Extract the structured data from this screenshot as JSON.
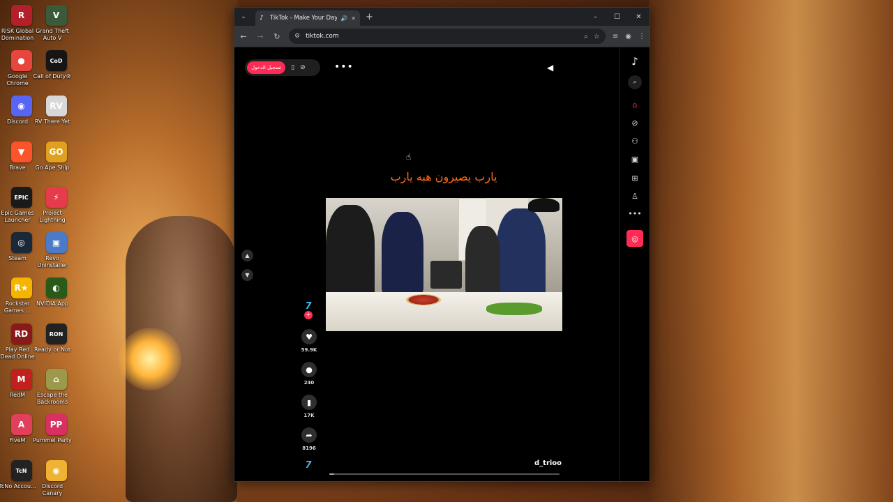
{
  "desktop": {
    "icons": [
      {
        "label": "RISK Global Domination",
        "icon": "risk-icon",
        "color": "#b3202a",
        "glyph": "R"
      },
      {
        "label": "Grand Theft Auto V",
        "icon": "gta-icon",
        "color": "#3a5a3a",
        "glyph": "V"
      },
      {
        "label": "Google Chrome",
        "icon": "chrome-icon",
        "color": "#e8453c",
        "glyph": "●"
      },
      {
        "label": "Call of Duty®",
        "icon": "cod-icon",
        "color": "#151515",
        "glyph": "CoD"
      },
      {
        "label": "Discord",
        "icon": "discord-icon",
        "color": "#5865f2",
        "glyph": "◉"
      },
      {
        "label": "RV There Yet",
        "icon": "rv-icon",
        "color": "#d8d8d8",
        "glyph": "RV"
      },
      {
        "label": "Brave",
        "icon": "brave-icon",
        "color": "#fb542b",
        "glyph": "▼"
      },
      {
        "label": "Go Ape Ship",
        "icon": "goapeship-icon",
        "color": "#e0a020",
        "glyph": "GO"
      },
      {
        "label": "Epic Games Launcher",
        "icon": "epic-icon",
        "color": "#1a1a1a",
        "glyph": "EPIC"
      },
      {
        "label": "Project Lightning",
        "icon": "lightning-icon",
        "color": "#e53b4b",
        "glyph": "⚡"
      },
      {
        "label": "Steam",
        "icon": "steam-icon",
        "color": "#1b2838",
        "glyph": "◎"
      },
      {
        "label": "Revo Uninstaller",
        "icon": "revo-icon",
        "color": "#4a7ac8",
        "glyph": "▣"
      },
      {
        "label": "Rockstar Games ...",
        "icon": "rockstar-icon",
        "color": "#f4b400",
        "glyph": "R★"
      },
      {
        "label": "NVIDIA App",
        "icon": "nvidia-icon",
        "color": "#2a5a1a",
        "glyph": "◐"
      },
      {
        "label": "Play Red Dead Online",
        "icon": "rdo-icon",
        "color": "#8a1a1a",
        "glyph": "RD"
      },
      {
        "label": "Ready or Not",
        "icon": "readyornot-icon",
        "color": "#222222",
        "glyph": "RON"
      },
      {
        "label": "RedM",
        "icon": "redm-icon",
        "color": "#c21f1f",
        "glyph": "M"
      },
      {
        "label": "Escape the Backrooms",
        "icon": "backrooms-icon",
        "color": "#9a9a4a",
        "glyph": "⌂"
      },
      {
        "label": "FiveM",
        "icon": "fivem-icon",
        "color": "#e0405a",
        "glyph": "A"
      },
      {
        "label": "Pummel Party",
        "icon": "pummel-icon",
        "color": "#d83060",
        "glyph": "PP"
      },
      {
        "label": "TcNo Accou...",
        "icon": "tcno-icon",
        "color": "#222222",
        "glyph": "TcN"
      },
      {
        "label": "Discord Canary",
        "icon": "discord-canary-icon",
        "color": "#f0b232",
        "glyph": "◉"
      }
    ]
  },
  "browser": {
    "tab_title": "TikTok - Make Your Day",
    "url": "tiktok.com",
    "new_tab": "+",
    "window_controls": {
      "minimize": "–",
      "maximize": "☐",
      "close": "✕"
    }
  },
  "tiktok": {
    "login_label": "تسجيل الدخول",
    "caption": "يارب يصيرون هبه يارب",
    "likes": "59.9K",
    "comments": "240",
    "saves": "17K",
    "shares": "8196",
    "username": "d_trioo",
    "progress_fraction": 0.02,
    "accent": "#fe2c55"
  }
}
